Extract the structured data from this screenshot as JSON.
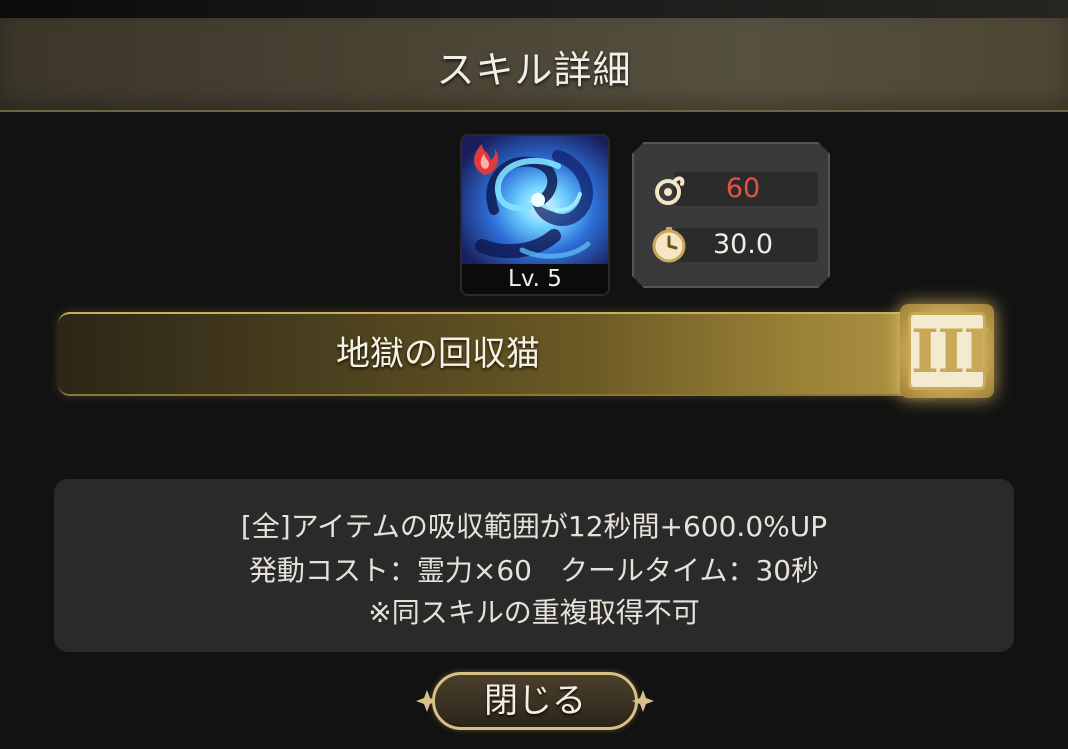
{
  "dialog": {
    "title": "スキル詳細"
  },
  "skill": {
    "icon": "fire-vortex-icon",
    "level_label": "Lv. 5",
    "name": "地獄の回収猫",
    "tier": "III",
    "cost": "60",
    "cooldown": "30.0",
    "description_lines": [
      "[全]アイテムの吸収範囲が12秒間+600.0%UP",
      "発動コスト：霊力×60　クールタイム：30秒",
      "※同スキルの重複取得不可"
    ]
  },
  "colors": {
    "cost_value": "#e0524a",
    "cooldown_value": "#f0ede6",
    "banner_gold": "#c9ae5b"
  },
  "buttons": {
    "close_label": "閉じる"
  }
}
